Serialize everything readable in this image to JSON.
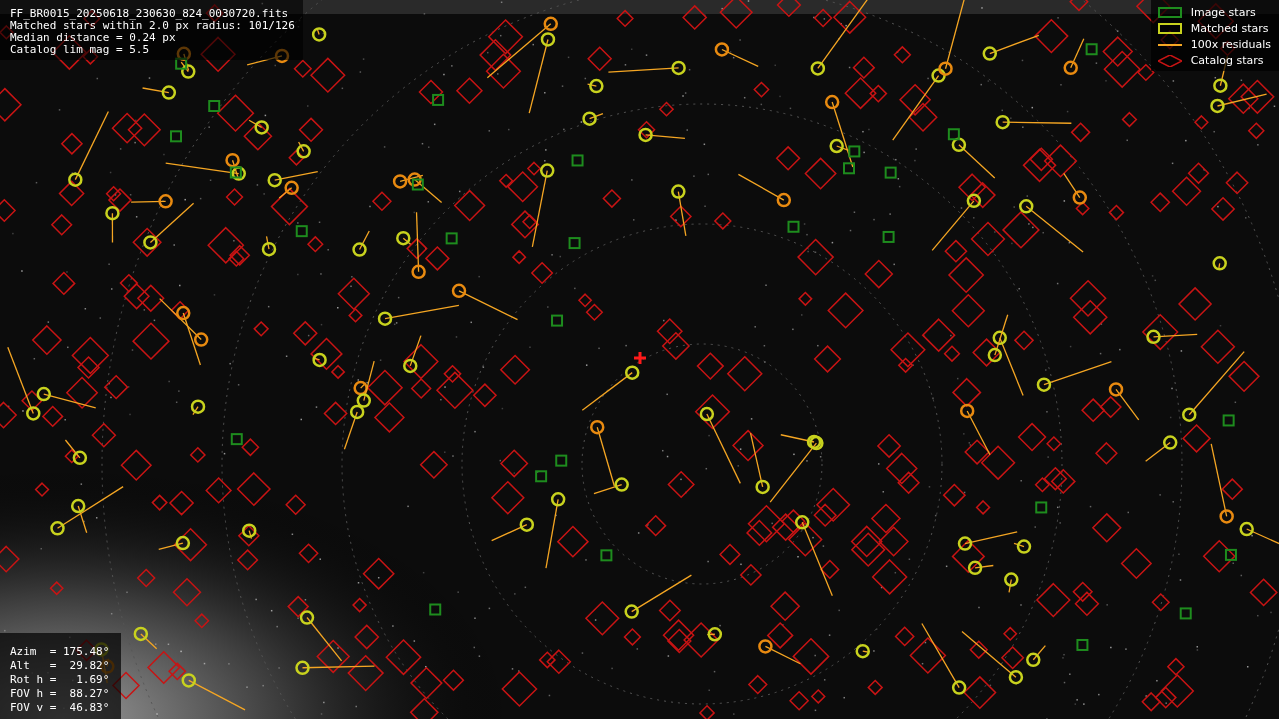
{
  "info_lines": [
    "FF_BR0015_20250618_230630_824_0030720.fits",
    "Matched stars within 2.0 px radius: 101/126",
    "Median distance = 0.24 px",
    "Catalog lim mag = 5.5"
  ],
  "legend": [
    {
      "kind": "image",
      "label": "Image stars"
    },
    {
      "kind": "matched",
      "label": "Matched stars"
    },
    {
      "kind": "residual",
      "label": "100x residuals"
    },
    {
      "kind": "catalog",
      "label": "Catalog stars"
    }
  ],
  "pointing": [
    "Azim  = 175.48°",
    "Alt   =  29.82°",
    "Rot h =   1.69°",
    "FOV h =  88.27°",
    "FOV v =  46.83°"
  ]
}
